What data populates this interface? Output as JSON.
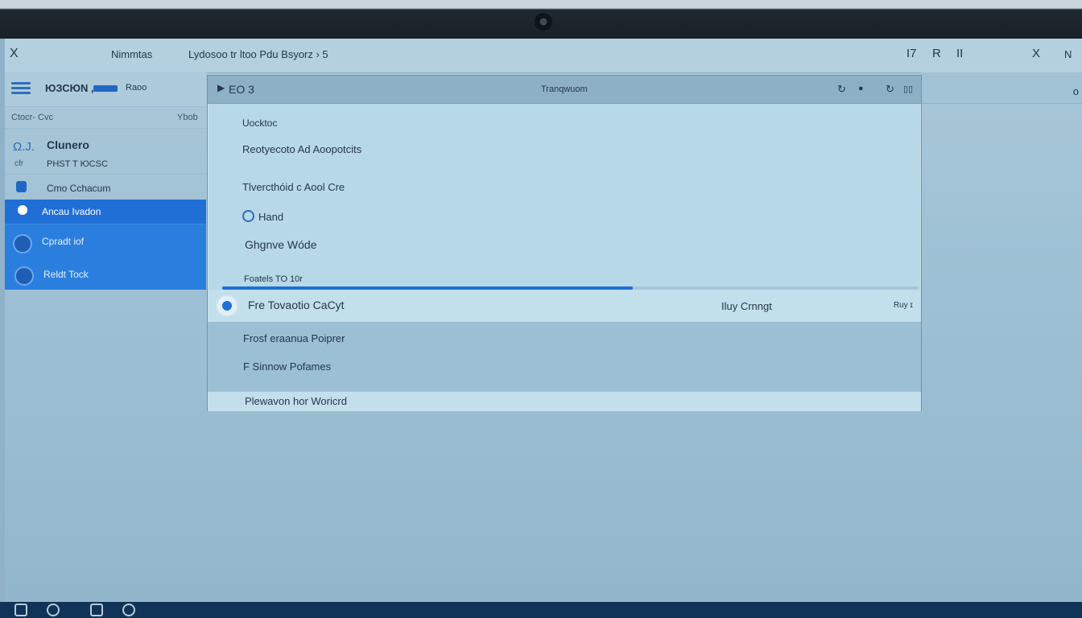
{
  "topbar": {
    "close": "X",
    "app_name": "Nimmtas",
    "path": "Lydosoo  tr ltoo  Pdu Bsyorz  ›  5",
    "controls": [
      "I7",
      "R",
      "II"
    ],
    "window_close": "X",
    "window_extra": "N"
  },
  "sidebar": {
    "brand": "ЮЗСЮN ,",
    "tag": "Raoo",
    "sub_left": "Ctocr-  Cvc",
    "sub_right": "Ybob",
    "user_icon": "Ω.J.",
    "user_name": "Clunero",
    "user_caption": "cfr",
    "user_sub": "PHST T ЮCSC",
    "items": [
      {
        "label": "Cmo Cchacum"
      },
      {
        "label": "Ancau Ivadon"
      },
      {
        "label": "Cpradt iof"
      },
      {
        "label": "Reldt Tock"
      }
    ]
  },
  "right_strip": {
    "letter": "o"
  },
  "dialog": {
    "header_number": "ЕО 3",
    "header_title": "Tranqwuom",
    "header_icons": [
      "↻",
      "●",
      "↻",
      "▯▯"
    ],
    "section_label": "Uocktoc",
    "line2": "Reotyecoto Ad Aoopotcits",
    "line3": "Tlvercthóid c Aool Cre",
    "line4": "Hand",
    "line5": "Ghgnve Wóde",
    "progress_label": "Foatels TO 10r",
    "progress_fraction": 0.59,
    "selected_label": "Fre Tovaotio CaCyt",
    "selected_mid": "Iluy Crnngt",
    "selected_end": "Ruy ɪ",
    "alt1": "Frosf eraanua Poiprer",
    "alt2": "F Sinnow Pofames",
    "footer": "Plewavon hor Woricrd"
  },
  "colors": {
    "accent": "#1f6fd6",
    "dialog_bg": "#b7d8e7",
    "taskbar": "#0f3457"
  }
}
